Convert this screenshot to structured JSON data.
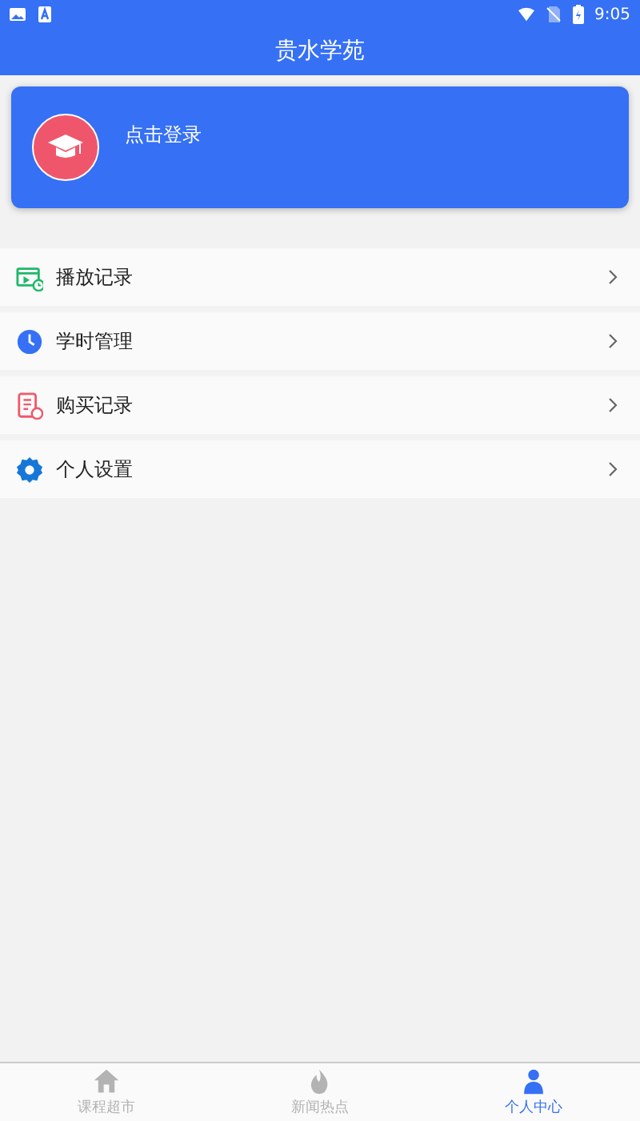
{
  "status_bar": {
    "time": "9:05"
  },
  "header": {
    "title": "贵水学苑"
  },
  "login_card": {
    "label": "点击登录"
  },
  "menu": [
    {
      "kind": "playback",
      "label": "播放记录"
    },
    {
      "kind": "hours",
      "label": "学时管理"
    },
    {
      "kind": "purchase",
      "label": "购买记录"
    },
    {
      "kind": "settings",
      "label": "个人设置"
    }
  ],
  "tabs": [
    {
      "kind": "home",
      "label": "课程超市",
      "selected": false
    },
    {
      "kind": "news",
      "label": "新闻热点",
      "selected": false
    },
    {
      "kind": "person",
      "label": "个人中心",
      "selected": true
    }
  ]
}
